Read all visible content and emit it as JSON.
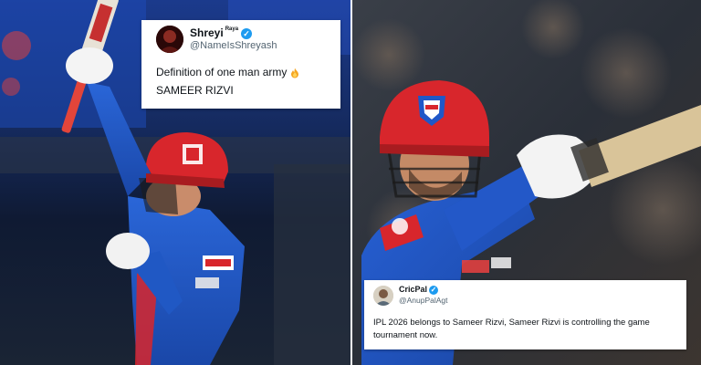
{
  "tweet_top": {
    "display_name": "Shreyi",
    "name_tag": "Raya",
    "handle": "@NameIsShreyash",
    "line1": "Definition of one man army",
    "line2": "SAMEER RIZVI",
    "emoji_icon": "fire-icon"
  },
  "tweet_bottom": {
    "display_name": "CricPal",
    "handle": "@AnupPalAgt",
    "line1": "IPL 2026 belongs to Sameer Rizvi, Sameer Rizvi is controlling the game",
    "line2": "tournament now."
  },
  "colors": {
    "verified": "#1d9bf0",
    "helmet_red": "#d8262c",
    "jersey_blue": "#1f57c8",
    "jersey_red": "#d8262c",
    "background_left": "#0d1b3a",
    "background_right": "#2b3038"
  }
}
